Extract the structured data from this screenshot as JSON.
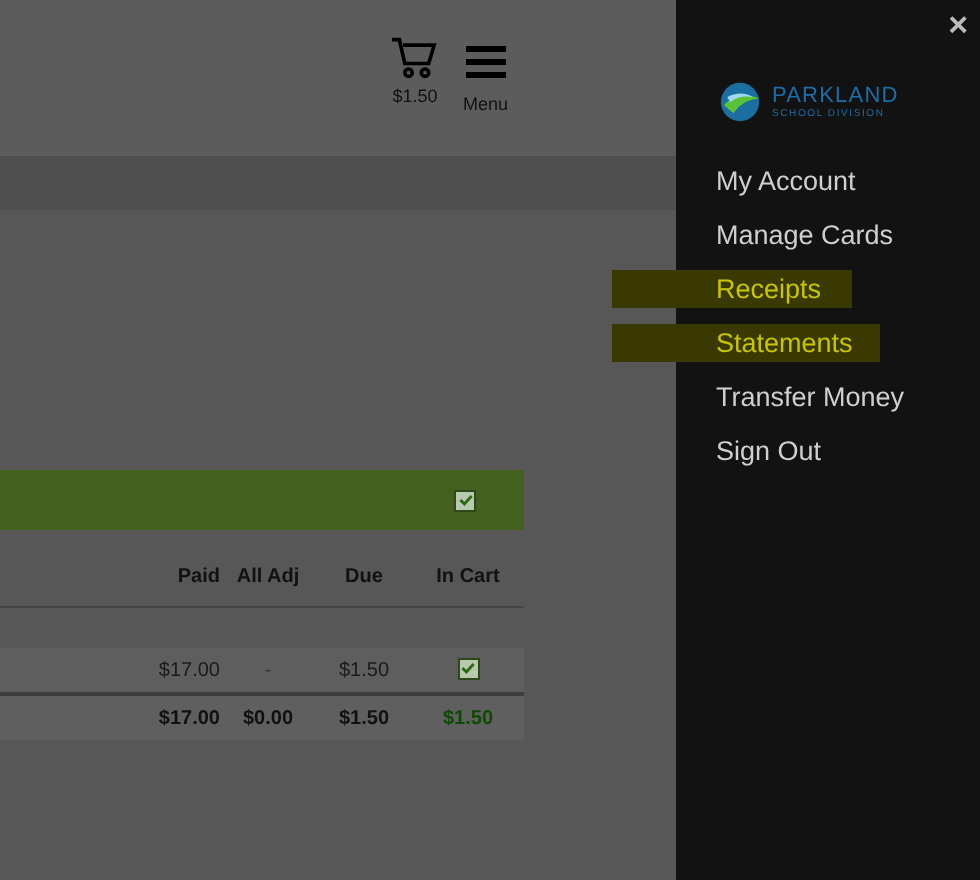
{
  "header": {
    "cart_total": "$1.50",
    "menu_label": "Menu"
  },
  "group_bar": {
    "checked": true
  },
  "table": {
    "columns": [
      "Paid",
      "All Adj",
      "Due",
      "In Cart"
    ],
    "rows": [
      {
        "cells": [
          "$17.00",
          "-",
          "$1.50"
        ],
        "in_cart": true
      }
    ],
    "totals": [
      "$17.00",
      "$0.00",
      "$1.50",
      "$1.50"
    ]
  },
  "drawer": {
    "close": "×",
    "logo": {
      "name": "PARKLAND",
      "subtitle": "SCHOOL DIVISION"
    },
    "items": [
      {
        "label": "My Account",
        "highlighted": false
      },
      {
        "label": "Manage Cards",
        "highlighted": false
      },
      {
        "label": "Receipts",
        "highlighted": true
      },
      {
        "label": "Statements",
        "highlighted": true
      },
      {
        "label": "Transfer Money",
        "highlighted": false
      },
      {
        "label": "Sign Out",
        "highlighted": false
      }
    ]
  }
}
